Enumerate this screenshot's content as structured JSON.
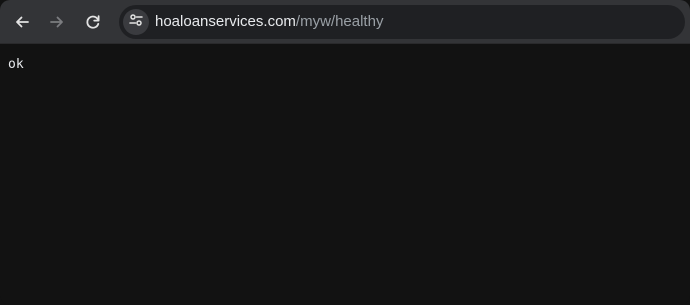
{
  "toolbar": {
    "back_icon": "arrow-left-icon",
    "forward_icon": "arrow-right-icon",
    "reload_icon": "reload-icon",
    "site_info_icon": "tune-icon"
  },
  "address_bar": {
    "host": "hoaloanservices.com",
    "path": "/myw/healthy"
  },
  "page": {
    "text": "ok"
  },
  "colors": {
    "toolbar_bg": "#333437",
    "omnibox_bg": "#1f2023",
    "page_bg": "#121212",
    "text": "#e8eaed",
    "muted_text": "#9aa0a6"
  }
}
